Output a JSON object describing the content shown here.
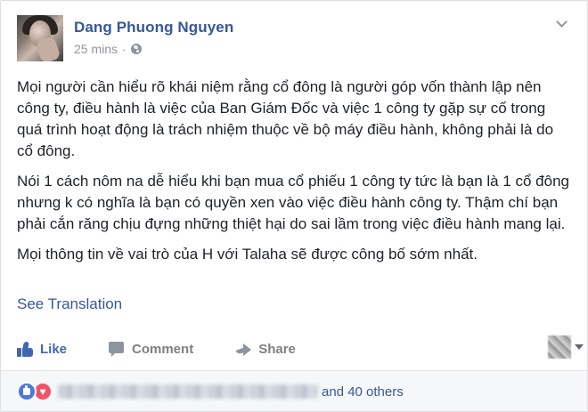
{
  "post": {
    "author": "Dang Phuong Nguyen",
    "time": "25 mins",
    "separator": "·",
    "privacy_icon": "globe-icon",
    "menu_icon": "chevron-down-icon",
    "paragraphs": [
      "Mọi người cần hiểu rõ khái niệm rằng cổ đông là người góp vốn thành lập nên công ty, điều hành là việc của Ban Giám Đốc và việc 1 công ty gặp sự cố trong quá trình hoạt động là trách nhiệm thuộc về bộ máy điều hành, không phải là do cổ đông.",
      "Nói 1 cách nôm na dễ hiểu khi bạn mua cổ phiếu 1 công ty tức là bạn là 1 cổ đông nhưng k có nghĩa là bạn có quyền xen vào việc điều hành công ty. Thậm chí bạn phải cắn răng chịu đựng những thiệt hại do sai lầm trong việc điều hành mang lại.",
      "Mọi thông tin về vai trò của H với Talaha sẽ được công bố sớm nhất."
    ],
    "see_translation": "See Translation"
  },
  "actions": {
    "like": "Like",
    "comment": "Comment",
    "share": "Share"
  },
  "reactions": {
    "icons": [
      "like-reaction-icon",
      "love-reaction-icon"
    ],
    "others_text": "and 40 others"
  },
  "colors": {
    "link_blue": "#365899",
    "like_blue": "#4267b2",
    "text": "#1d2129",
    "muted": "#90949c",
    "love_red": "#f25268"
  }
}
